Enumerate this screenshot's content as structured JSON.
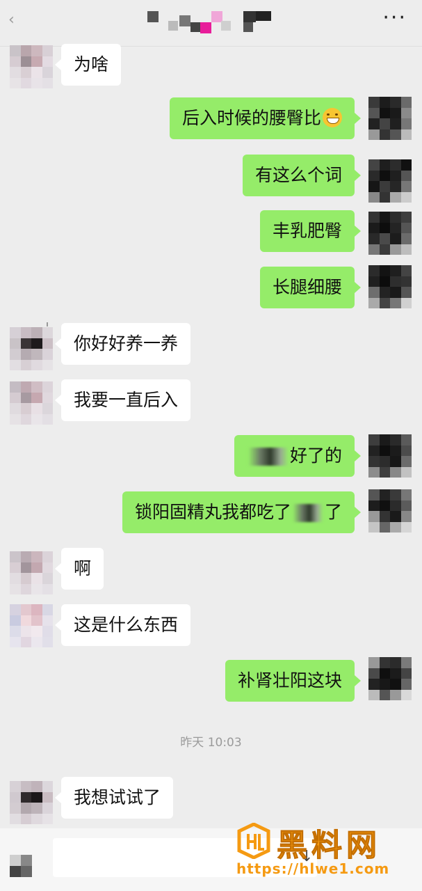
{
  "header": {
    "back_icon": "chevron-left-icon",
    "more_icon": "more-dots-icon",
    "more_label": "···"
  },
  "messages": [
    {
      "side": "in",
      "text": "为啥"
    },
    {
      "side": "out",
      "text": "后入时候的腰臀比",
      "emoji": "grinning-face-icon"
    },
    {
      "side": "out",
      "text": "有这么个词"
    },
    {
      "side": "out",
      "text": "丰乳肥臀"
    },
    {
      "side": "out",
      "text": "长腿细腰"
    },
    {
      "side": "in",
      "text": "你好好养一养"
    },
    {
      "side": "in",
      "text": "我要一直后入"
    },
    {
      "side": "out",
      "text_before": "",
      "text_after": "好了的",
      "redacted": true
    },
    {
      "side": "out",
      "text_before": "锁阳固精丸我都吃了",
      "text_after": "了",
      "redacted": true
    },
    {
      "side": "in",
      "text": "啊"
    },
    {
      "side": "in",
      "text": "这是什么东西"
    },
    {
      "side": "out",
      "text": "补肾壮阳这块"
    },
    {
      "side": "in",
      "text": "我想试试了"
    }
  ],
  "timestamp": "昨天 10:03",
  "input": {
    "placeholder": "",
    "voice_icon": "voice-icon"
  },
  "watermark": {
    "name": "黑料网",
    "url": "https://hlwe1.com",
    "logo_icon": "hl-logo-icon"
  },
  "colors": {
    "outgoing_bubble": "#95ec69",
    "incoming_bubble": "#ffffff",
    "background": "#ededed",
    "watermark": "#f59a12"
  }
}
